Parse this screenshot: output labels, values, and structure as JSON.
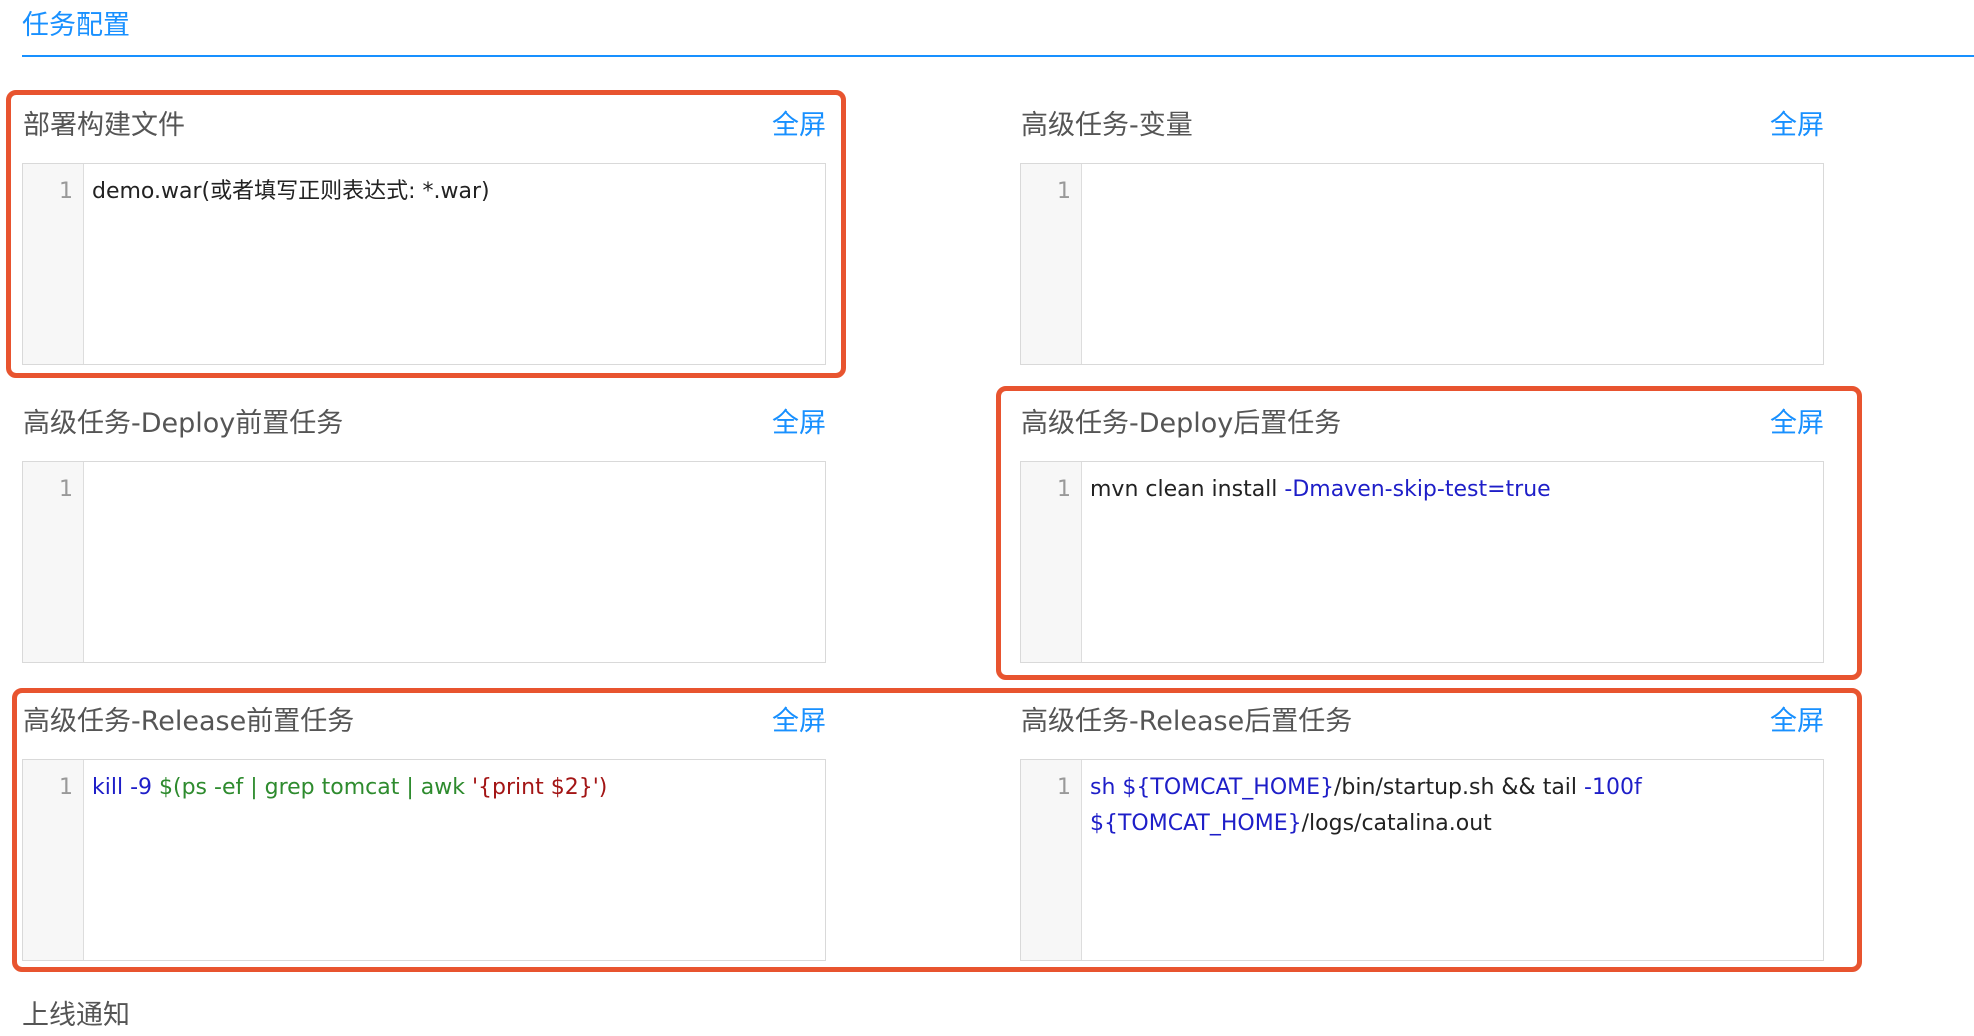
{
  "section": {
    "title": "任务配置"
  },
  "fullscreen_label": "全屏",
  "panels": {
    "deploy_build_file": {
      "title": "部署构建文件",
      "line_number": "1",
      "code": "demo.war(或者填写正则表达式: *.war)"
    },
    "advanced_variables": {
      "title": "高级任务-变量",
      "line_number": "1"
    },
    "deploy_pre_task": {
      "title": "高级任务-Deploy前置任务",
      "line_number": "1"
    },
    "deploy_post_task": {
      "title": "高级任务-Deploy后置任务",
      "line_number": "1",
      "code": {
        "t1": "mvn clean install ",
        "t2": "-Dmaven-skip-test=true"
      }
    },
    "release_pre_task": {
      "title": "高级任务-Release前置任务",
      "line_number": "1",
      "code": {
        "t1": "kill -9 ",
        "t2": "$(ps -ef | grep tomcat | awk ",
        "t3": "'{print $2}')"
      }
    },
    "release_post_task": {
      "title": "高级任务-Release后置任务",
      "line_number": "1",
      "code": {
        "t1": "sh ${TOMCAT_HOME}",
        "t2": "/bin/startup.sh && tail ",
        "t3": "-100f",
        "t4": "${TOMCAT_HOME}",
        "t5": "/logs/catalina.out"
      }
    }
  },
  "next_section": {
    "title": "上线通知"
  },
  "colors": {
    "accent": "#1890ff",
    "highlight": "#e8542f",
    "keyword": "#1e1ec8",
    "string": "#2e8b2e",
    "literal": "#a31515"
  }
}
